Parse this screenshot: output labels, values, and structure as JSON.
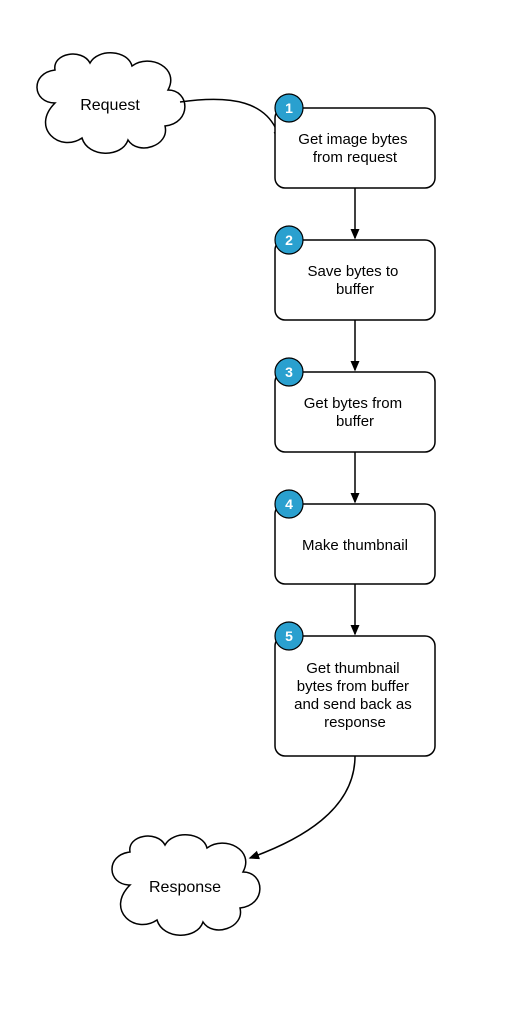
{
  "diagram": {
    "start": {
      "label": "Request"
    },
    "end": {
      "label": "Response"
    },
    "steps": [
      {
        "num": "1",
        "label_lines": [
          "Get image bytes",
          "from request"
        ]
      },
      {
        "num": "2",
        "label_lines": [
          "Save bytes to",
          "buffer"
        ]
      },
      {
        "num": "3",
        "label_lines": [
          "Get bytes from",
          "buffer"
        ]
      },
      {
        "num": "4",
        "label_lines": [
          "Make thumbnail"
        ]
      },
      {
        "num": "5",
        "label_lines": [
          "Get thumbnail",
          "bytes from buffer",
          "and send back as",
          "response"
        ]
      }
    ]
  },
  "colors": {
    "badge": "#2aa0cf",
    "stroke": "#000000",
    "bg": "#ffffff"
  }
}
